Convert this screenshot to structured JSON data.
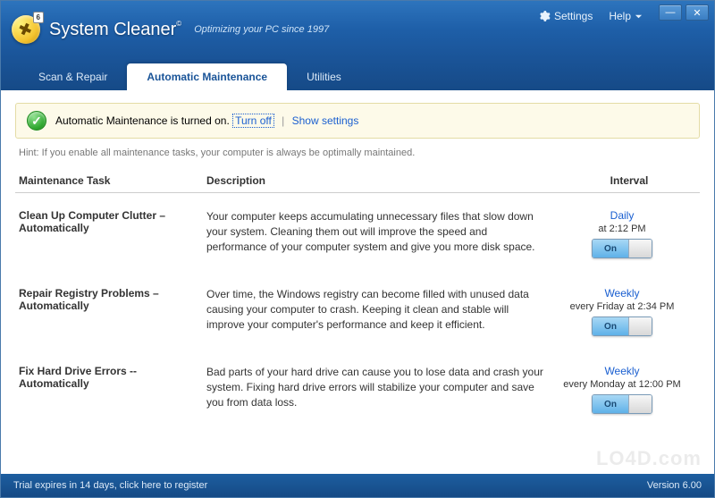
{
  "app": {
    "name": "System Cleaner",
    "badge_version": "6",
    "tagline": "Optimizing your PC since 1997",
    "copyright_symbol": "©"
  },
  "header": {
    "settings_label": "Settings",
    "help_label": "Help"
  },
  "tabs": [
    {
      "id": "scan",
      "label": "Scan & Repair",
      "active": false
    },
    {
      "id": "auto",
      "label": "Automatic Maintenance",
      "active": true
    },
    {
      "id": "util",
      "label": "Utilities",
      "active": false
    }
  ],
  "notice": {
    "text": "Automatic Maintenance is turned on.",
    "turn_off": "Turn off",
    "show_settings": "Show settings"
  },
  "hint": "Hint: If you enable all maintenance tasks, your computer is always be optimally maintained.",
  "columns": {
    "task": "Maintenance Task",
    "desc": "Description",
    "interval": "Interval"
  },
  "tasks": [
    {
      "name": "Clean Up Computer Clutter – Automatically",
      "desc": "Your computer keeps accumulating unnecessary files that slow down your system. Cleaning them out will improve the speed and performance of your computer system and give you more disk space.",
      "freq": "Daily",
      "time": "at 2:12 PM",
      "state": "On"
    },
    {
      "name": "Repair Registry Problems – Automatically",
      "desc": "Over time, the Windows registry can become filled with unused data causing your computer to crash. Keeping it clean and stable will improve your computer's performance and keep it efficient.",
      "freq": "Weekly",
      "time": "every Friday at 2:34 PM",
      "state": "On"
    },
    {
      "name": "Fix Hard Drive Errors -- Automatically",
      "desc": "Bad parts of your hard drive can cause you to lose data and crash your system. Fixing hard drive errors will stabilize your computer and save you from data loss.",
      "freq": "Weekly",
      "time": "every Monday at 12:00 PM",
      "state": "On"
    }
  ],
  "footer": {
    "trial": "Trial expires in 14 days, click here to register",
    "version": "Version 6.00"
  },
  "watermark": "LO4D.com"
}
